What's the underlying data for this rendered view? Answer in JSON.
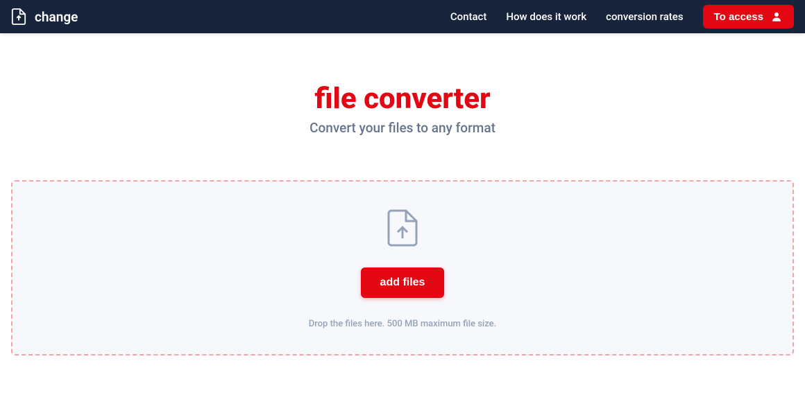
{
  "header": {
    "logo_text": "change",
    "nav": {
      "contact": "Contact",
      "how_it_works": "How does it work",
      "conversion_rates": "conversion rates"
    },
    "access_button": "To access"
  },
  "main": {
    "title": "file converter",
    "subtitle": "Convert your files to any format",
    "dropzone": {
      "add_files_button": "add files",
      "hint": "Drop the files here. 500 MB maximum file size."
    }
  },
  "colors": {
    "primary_red": "#e30613",
    "header_bg": "#18243b",
    "subtitle_gray": "#64748b",
    "hint_gray": "#94a3b8",
    "dropzone_bg": "#f6f8fc",
    "dropzone_border": "#f5a3a8"
  }
}
